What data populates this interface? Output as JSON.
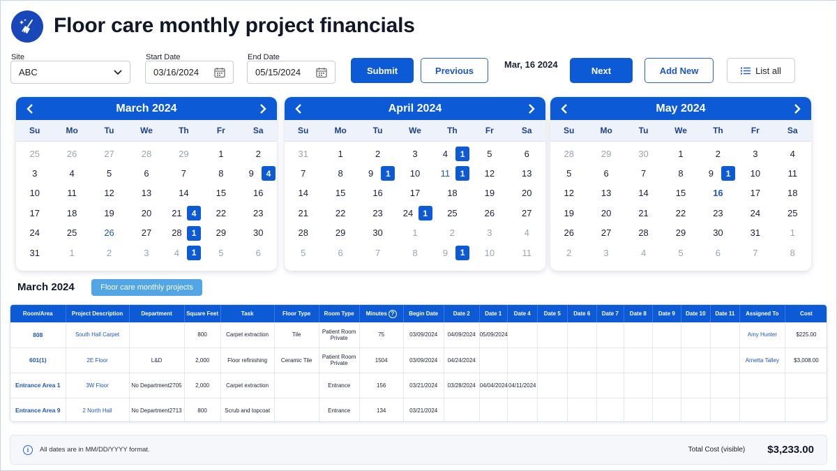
{
  "header": {
    "title": "Floor care monthly project financials"
  },
  "controls": {
    "site_label": "Site",
    "site_value": "ABC",
    "start_label": "Start Date",
    "start_value": "03/16/2024",
    "end_label": "End Date",
    "end_value": "05/15/2024",
    "submit": "Submit",
    "previous": "Previous",
    "current_date": "Mar, 16 2024",
    "next": "Next",
    "add_new": "Add New",
    "list_all": "List all"
  },
  "dow": [
    "Su",
    "Mo",
    "Tu",
    "We",
    "Th",
    "Fr",
    "Sa"
  ],
  "calendars": [
    {
      "month": "March 2024",
      "days": [
        {
          "d": "25",
          "s": "dim"
        },
        {
          "d": "26",
          "s": "dim"
        },
        {
          "d": "27",
          "s": "dim"
        },
        {
          "d": "28",
          "s": "dim"
        },
        {
          "d": "29",
          "s": "dim"
        },
        {
          "d": "1"
        },
        {
          "d": "2"
        },
        {
          "d": "3"
        },
        {
          "d": "4"
        },
        {
          "d": "5"
        },
        {
          "d": "6"
        },
        {
          "d": "7"
        },
        {
          "d": "8"
        },
        {
          "d": "9",
          "b": "4"
        },
        {
          "d": "10"
        },
        {
          "d": "11"
        },
        {
          "d": "12"
        },
        {
          "d": "13"
        },
        {
          "d": "14"
        },
        {
          "d": "15"
        },
        {
          "d": "16"
        },
        {
          "d": "17"
        },
        {
          "d": "18"
        },
        {
          "d": "19"
        },
        {
          "d": "20"
        },
        {
          "d": "21",
          "b": "4"
        },
        {
          "d": "22"
        },
        {
          "d": "23"
        },
        {
          "d": "24"
        },
        {
          "d": "25"
        },
        {
          "d": "26",
          "s": "blue"
        },
        {
          "d": "27"
        },
        {
          "d": "28",
          "b": "1"
        },
        {
          "d": "29"
        },
        {
          "d": "30"
        },
        {
          "d": "31"
        },
        {
          "d": "1",
          "s": "dim"
        },
        {
          "d": "2",
          "s": "dim"
        },
        {
          "d": "3",
          "s": "dim"
        },
        {
          "d": "4",
          "s": "dim",
          "b": "1"
        },
        {
          "d": "5",
          "s": "dim"
        },
        {
          "d": "6",
          "s": "dim"
        }
      ]
    },
    {
      "month": "April 2024",
      "days": [
        {
          "d": "31",
          "s": "dim"
        },
        {
          "d": "1"
        },
        {
          "d": "2"
        },
        {
          "d": "3"
        },
        {
          "d": "4",
          "b": "1"
        },
        {
          "d": "5"
        },
        {
          "d": "6"
        },
        {
          "d": "7"
        },
        {
          "d": "8"
        },
        {
          "d": "9",
          "b": "1"
        },
        {
          "d": "10"
        },
        {
          "d": "11",
          "s": "blue",
          "b": "1"
        },
        {
          "d": "12"
        },
        {
          "d": "13"
        },
        {
          "d": "14"
        },
        {
          "d": "15"
        },
        {
          "d": "16"
        },
        {
          "d": "17"
        },
        {
          "d": "18"
        },
        {
          "d": "19"
        },
        {
          "d": "20"
        },
        {
          "d": "21"
        },
        {
          "d": "22"
        },
        {
          "d": "23"
        },
        {
          "d": "24",
          "b": "1"
        },
        {
          "d": "25"
        },
        {
          "d": "26"
        },
        {
          "d": "27"
        },
        {
          "d": "28"
        },
        {
          "d": "29"
        },
        {
          "d": "30"
        },
        {
          "d": "1",
          "s": "dim"
        },
        {
          "d": "2",
          "s": "dim"
        },
        {
          "d": "3",
          "s": "dim"
        },
        {
          "d": "4",
          "s": "dim"
        },
        {
          "d": "5",
          "s": "dim"
        },
        {
          "d": "6",
          "s": "dim"
        },
        {
          "d": "7",
          "s": "dim"
        },
        {
          "d": "8",
          "s": "dim"
        },
        {
          "d": "9",
          "s": "dim",
          "b": "1"
        },
        {
          "d": "10",
          "s": "dim"
        },
        {
          "d": "11",
          "s": "dim"
        }
      ]
    },
    {
      "month": "May 2024",
      "days": [
        {
          "d": "28",
          "s": "dim"
        },
        {
          "d": "29",
          "s": "dim"
        },
        {
          "d": "30",
          "s": "dim"
        },
        {
          "d": "1"
        },
        {
          "d": "2"
        },
        {
          "d": "3"
        },
        {
          "d": "4"
        },
        {
          "d": "5"
        },
        {
          "d": "6"
        },
        {
          "d": "7"
        },
        {
          "d": "8"
        },
        {
          "d": "9",
          "b": "1"
        },
        {
          "d": "10"
        },
        {
          "d": "11"
        },
        {
          "d": "12"
        },
        {
          "d": "13"
        },
        {
          "d": "14"
        },
        {
          "d": "15"
        },
        {
          "d": "16",
          "s": "blue bold"
        },
        {
          "d": "17"
        },
        {
          "d": "18"
        },
        {
          "d": "19"
        },
        {
          "d": "20"
        },
        {
          "d": "21"
        },
        {
          "d": "22"
        },
        {
          "d": "23"
        },
        {
          "d": "24"
        },
        {
          "d": "25"
        },
        {
          "d": "26"
        },
        {
          "d": "27"
        },
        {
          "d": "28"
        },
        {
          "d": "29"
        },
        {
          "d": "30"
        },
        {
          "d": "31"
        },
        {
          "d": "1",
          "s": "dim"
        },
        {
          "d": "2",
          "s": "dim"
        },
        {
          "d": "3",
          "s": "dim"
        },
        {
          "d": "4",
          "s": "dim"
        },
        {
          "d": "5",
          "s": "dim"
        },
        {
          "d": "6",
          "s": "dim"
        },
        {
          "d": "7",
          "s": "dim"
        },
        {
          "d": "8",
          "s": "dim"
        }
      ]
    }
  ],
  "section": {
    "title": "March 2024",
    "pill": "Floor care monthly projects"
  },
  "table": {
    "columns": [
      "Room/Area",
      "Project Description",
      "Department",
      "Square Feet",
      "Task",
      "Floor Type",
      "Room Type",
      "Minutes",
      "Begin Date",
      "Date 2",
      "Date 1",
      "Date 4",
      "Date 5",
      "Date 6",
      "Date 7",
      "Date 8",
      "Date 9",
      "Date 10",
      "Date 11",
      "Assigned To",
      "Cost"
    ],
    "rows": [
      [
        "808",
        "South Hall Carpet",
        "",
        "800",
        "Carpet extraction",
        "Tile",
        "Patient Room Private",
        "75",
        "03/09/2024",
        "04/09/2024",
        "05/09/2024",
        "",
        "",
        "",
        "",
        "",
        "",
        "",
        "",
        "Amy Hunter",
        "$225.00"
      ],
      [
        "601(1)",
        "2E Floor",
        "L&D",
        "2,000",
        "Floor refinishing",
        "Ceramic Tile",
        "Patient Room Private",
        "1504",
        "03/09/2024",
        "04/24/2024",
        "",
        "",
        "",
        "",
        "",
        "",
        "",
        "",
        "",
        "Arnetta Talley",
        "$3,008.00"
      ],
      [
        "Entrance Area 1",
        "3W Floor",
        "No Department2705",
        "2,000",
        "Carpet extraction",
        "",
        "Entrance",
        "156",
        "03/21/2024",
        "03/28/2024",
        "04/04/2024",
        "04/11/2024",
        "",
        "",
        "",
        "",
        "",
        "",
        "",
        "",
        ""
      ],
      [
        "Entrance Area 9",
        "2 North Hall",
        "No Department2713",
        "800",
        "Scrub and topcoat",
        "",
        "Entrance",
        "134",
        "03/21/2024",
        "",
        "",
        "",
        "",
        "",
        "",
        "",
        "",
        "",
        "",
        "",
        ""
      ]
    ]
  },
  "footer": {
    "note": "All dates are in MM/DD/YYYY format.",
    "total_label": "Total Cost (visible)",
    "total_value": "$3,233.00"
  },
  "colors": {
    "primary": "#0d5ad6",
    "pill": "#53a6e6",
    "link": "#1d55c4"
  }
}
